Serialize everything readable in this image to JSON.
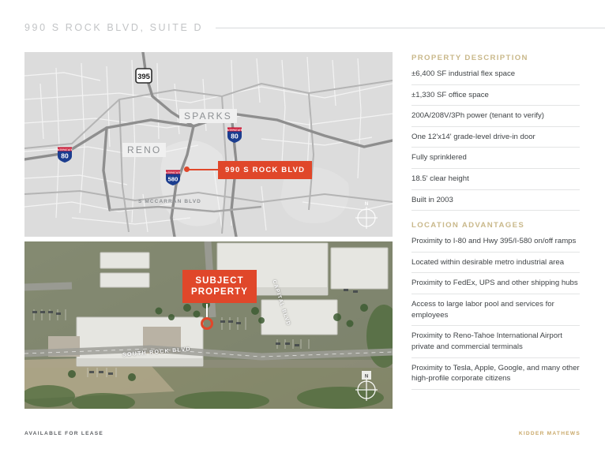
{
  "header": {
    "title": "990 S ROCK BLVD, SUITE D"
  },
  "map": {
    "labels": {
      "sparks": "SPARKS",
      "reno": "RENO",
      "mccarran": "S MCCARRAN BLVD",
      "shield_80_west": "80",
      "shield_80_east": "80",
      "shield_580": "580",
      "shield_us_395": "395",
      "interstate_word": "INTERSTATE",
      "compass_north": "N"
    },
    "callout": "990 S ROCK BLVD",
    "accent_color": "#e0472a",
    "base_color": "#dcdcdc"
  },
  "aerial": {
    "callout_line1": "SUBJECT",
    "callout_line2": "PROPERTY",
    "street_south_rock": "SOUTH ROCK BLVD",
    "street_capital": "CAPITAL BLVD",
    "compass_north": "N",
    "accent_color": "#e0472a"
  },
  "property_description": {
    "heading": "PROPERTY DESCRIPTION",
    "items": [
      "±6,400 SF industrial flex space",
      "±1,330 SF office space",
      "200A/208V/3Ph power (tenant to verify)",
      "One 12'x14' grade-level drive-in door",
      "Fully sprinklered",
      "18.5' clear height",
      "Built in 2003"
    ]
  },
  "location_advantages": {
    "heading": "LOCATION ADVANTAGES",
    "items": [
      "Proximity to I-80 and Hwy 395/I-580 on/off ramps",
      "Located within desirable metro industrial area",
      "Proximity to FedEx, UPS and other shipping hubs",
      "Access to large labor pool and services for employees",
      "Proximity to Reno-Tahoe International Airport private and commercial terminals",
      "Proximity to Tesla, Apple, Google, and many other high-profile corporate citizens"
    ]
  },
  "footer": {
    "left": "AVAILABLE FOR LEASE",
    "right": "KIDDER MATHEWS",
    "brand_color": "#c9a96a"
  }
}
